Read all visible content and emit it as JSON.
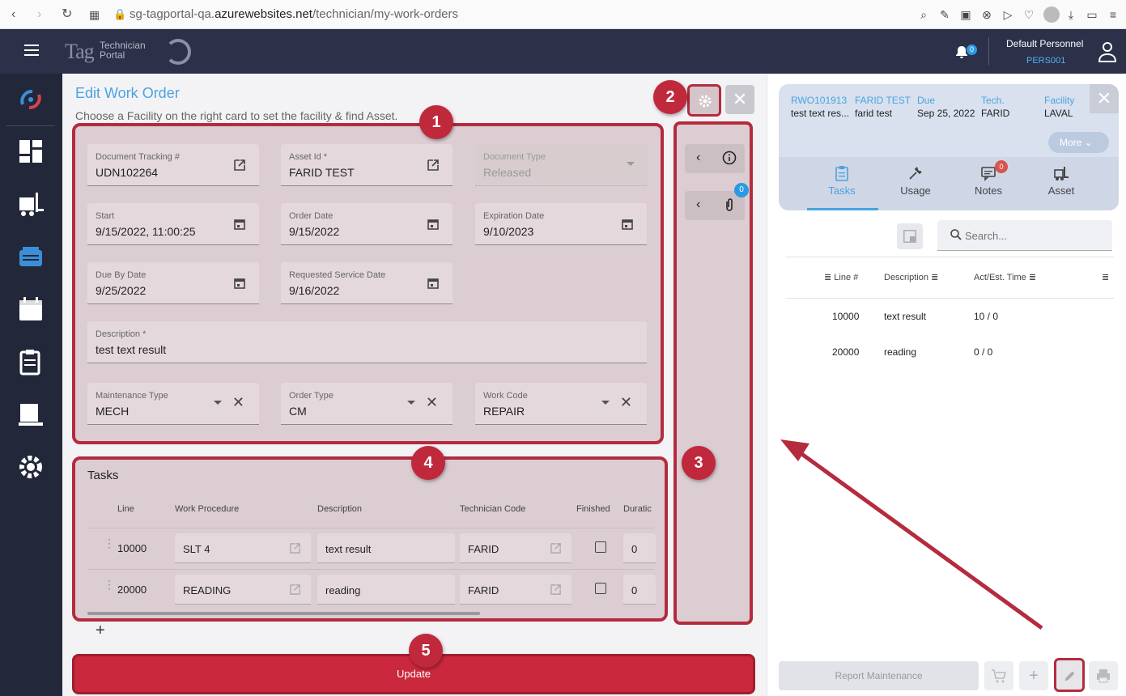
{
  "browser": {
    "url_prefix": "sg-tagportal-qa.",
    "url_host": "azurewebsites.net",
    "url_path": "/technician/my-work-orders"
  },
  "header": {
    "logo_text": "Tag",
    "portal_line1": "Technician",
    "portal_line2": "Portal",
    "notifications_count": "0",
    "user_name": "Default Personnel",
    "user_code": "PERS001"
  },
  "sidebar": {
    "items": [
      "logo-icon",
      "dashboard-icon",
      "forklift-icon",
      "work-orders-icon",
      "calendar-icon",
      "clipboard-icon",
      "reports-icon",
      "settings-icon"
    ]
  },
  "page": {
    "title": "Edit Work Order",
    "subtitle": "Choose a Facility on the right card to set the facility & find Asset."
  },
  "form": {
    "document_tracking": {
      "label": "Document Tracking #",
      "value": "UDN102264"
    },
    "asset_id": {
      "label": "Asset Id *",
      "value": "FARID TEST"
    },
    "document_type": {
      "label": "Document Type",
      "value": "Released"
    },
    "start": {
      "label": "Start",
      "value": "9/15/2022, 11:00:25"
    },
    "order_date": {
      "label": "Order Date",
      "value": "9/15/2022"
    },
    "expiration_date": {
      "label": "Expiration Date",
      "value": "9/10/2023"
    },
    "due_by_date": {
      "label": "Due By Date",
      "value": "9/25/2022"
    },
    "requested_service_date": {
      "label": "Requested Service Date",
      "value": "9/16/2022"
    },
    "description": {
      "label": "Description *",
      "value": "test text result"
    },
    "maintenance_type": {
      "label": "Maintenance Type",
      "value": "MECH"
    },
    "order_type": {
      "label": "Order Type",
      "value": "CM"
    },
    "work_code": {
      "label": "Work Code",
      "value": "REPAIR"
    }
  },
  "tasks": {
    "title": "Tasks",
    "columns": [
      "Line",
      "Work Procedure",
      "Description",
      "Technician Code",
      "Finished",
      "Duratic"
    ],
    "rows": [
      {
        "line": "10000",
        "procedure": "SLT 4",
        "description": "text result",
        "technician": "FARID",
        "finished": false,
        "duration": "0"
      },
      {
        "line": "20000",
        "procedure": "READING",
        "description": "reading",
        "technician": "FARID",
        "finished": false,
        "duration": "0"
      }
    ],
    "add_label": "+"
  },
  "side_panel": {
    "attachments_count": "0"
  },
  "buttons": {
    "close": "✕",
    "update": "Update"
  },
  "callouts": [
    "1",
    "2",
    "3",
    "4",
    "5"
  ],
  "right_panel": {
    "order_id": "RWO101913",
    "asset_name": "FARID TEST",
    "description_short": "test text res...",
    "asset_desc": "farid test",
    "due_label": "Due",
    "due_value": "Sep 25, 2022",
    "tech_label": "Tech.",
    "tech_value": "FARID",
    "facility_label": "Facility",
    "facility_value": "LAVAL",
    "more_label": "More",
    "tabs": [
      {
        "label": "Tasks",
        "icon": "clipboard-icon"
      },
      {
        "label": "Usage",
        "icon": "wrench-icon"
      },
      {
        "label": "Notes",
        "icon": "notes-icon"
      },
      {
        "label": "Asset",
        "icon": "forklift-icon"
      }
    ],
    "notes_count": "0",
    "search_placeholder": "Search...",
    "table_columns": [
      "Line #",
      "Description",
      "Act/Est. Time"
    ],
    "table_rows": [
      {
        "line": "10000",
        "description": "text result",
        "time": "10 / 0"
      },
      {
        "line": "20000",
        "description": "reading",
        "time": "0 / 0"
      }
    ],
    "report_label": "Report Maintenance"
  },
  "colors": {
    "accent": "#4aa3e0",
    "highlight": "#b52b3e",
    "update": "#c9283d",
    "appbar": "#2c3049"
  }
}
